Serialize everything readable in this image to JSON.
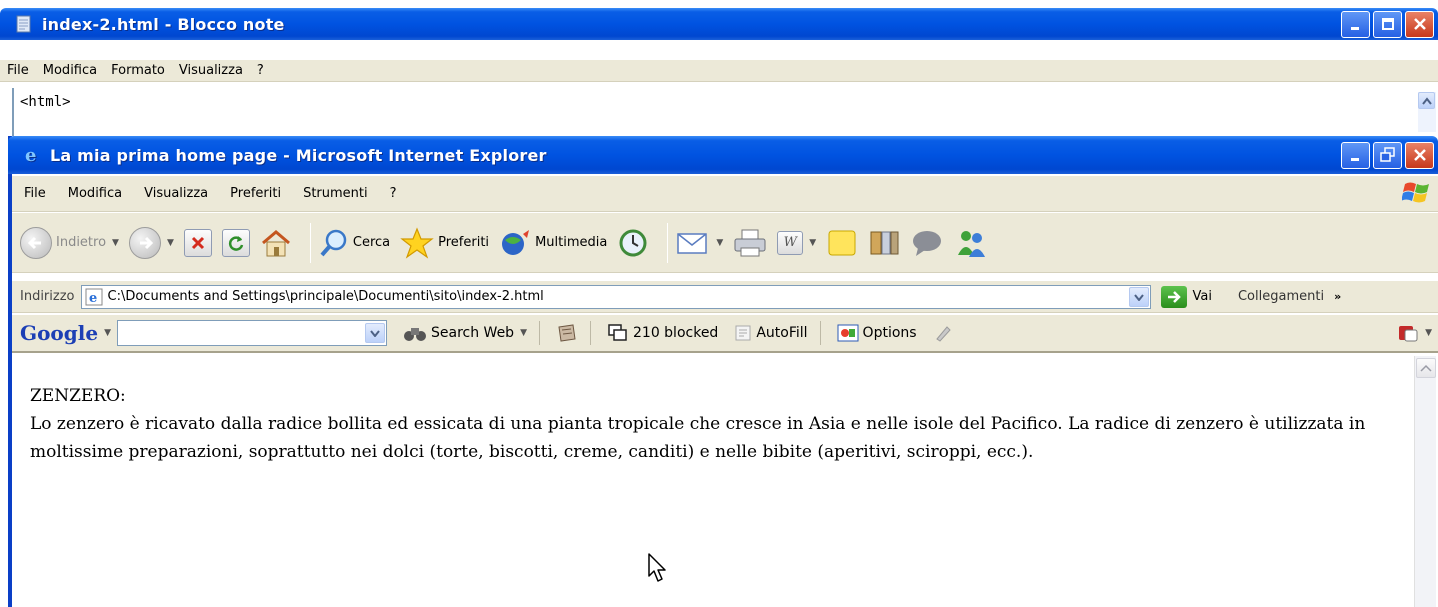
{
  "notepad": {
    "title": "index-2.html - Blocco note",
    "menu": [
      "File",
      "Modifica",
      "Formato",
      "Visualizza",
      "?"
    ],
    "content": "<html>"
  },
  "ie": {
    "title": "La mia prima home page - Microsoft Internet Explorer",
    "menu": [
      "File",
      "Modifica",
      "Visualizza",
      "Preferiti",
      "Strumenti",
      "?"
    ],
    "toolbar": {
      "back": "Indietro",
      "search": "Cerca",
      "favorites": "Preferiti",
      "media": "Multimedia"
    },
    "address": {
      "label": "Indirizzo",
      "value": "C:\\Documents and Settings\\principale\\Documenti\\sito\\index-2.html",
      "go": "Vai",
      "links": "Collegamenti",
      "links_more": "»"
    },
    "google": {
      "logo": "Google",
      "search_web": "Search Web",
      "blocked": "210 blocked",
      "autofill": "AutoFill",
      "options": "Options"
    },
    "page": {
      "heading": "ZENZERO:",
      "body": "Lo zenzero è ricavato dalla radice bollita ed essicata di una pianta tropicale che cresce in Asia e nelle isole del Pacifico. La radice di zenzero è utilizzata in moltissime preparazioni, soprattutto nei dolci (torte, biscotti, creme, canditi) e nelle bibite (aperitivi, sciroppi, ecc.)."
    }
  },
  "colors": {
    "titlebar": "#0053e1",
    "chrome": "#ece9d8",
    "close_button": "#c7381c"
  }
}
